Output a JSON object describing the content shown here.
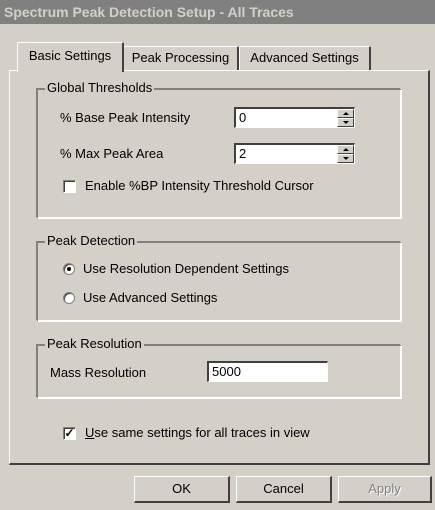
{
  "window": {
    "title": "Spectrum Peak Detection Setup - All Traces"
  },
  "tabs": [
    {
      "label": "Basic Settings",
      "active": true
    },
    {
      "label": "Peak Processing",
      "active": false
    },
    {
      "label": "Advanced Settings",
      "active": false
    }
  ],
  "global_thresholds": {
    "title": "Global Thresholds",
    "base_peak_label": "% Base Peak Intensity",
    "base_peak_value": "0",
    "max_peak_label": "% Max Peak Area",
    "max_peak_value": "2",
    "cursor_label": "Enable %BP Intensity Threshold Cursor",
    "cursor_checked": false
  },
  "peak_detection": {
    "title": "Peak Detection",
    "option1_label": "Use Resolution Dependent Settings",
    "option1_selected": true,
    "option2_label": "Use Advanced Settings",
    "option2_selected": false
  },
  "peak_resolution": {
    "title": "Peak Resolution",
    "mass_label": "Mass Resolution",
    "mass_value": "5000"
  },
  "same_settings": {
    "label_first": "U",
    "label_rest": "se same settings for all traces in view",
    "checked": true
  },
  "buttons": {
    "ok": "OK",
    "cancel": "Cancel",
    "apply": "Apply"
  }
}
